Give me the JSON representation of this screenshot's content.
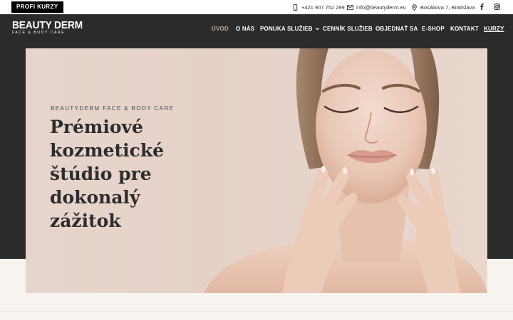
{
  "topbar": {
    "profi_button": "PROFI KURZY",
    "phone": "+421 907 752 299",
    "email": "info@beautyderm.eu",
    "address": "Bosákova 7, Bratislava"
  },
  "logo": {
    "main": "BEAUTY DERM",
    "sub": "FACE & BODY CARE"
  },
  "nav": {
    "items": [
      {
        "label": "ÚVOD"
      },
      {
        "label": "O NÁS"
      },
      {
        "label": "PONUKA SLUŽIEB"
      },
      {
        "label": "CENNÍK SLUŽIEB"
      },
      {
        "label": "OBJEDNAŤ SA"
      },
      {
        "label": "E-SHOP"
      },
      {
        "label": "KONTAKT"
      },
      {
        "label": "KURZY"
      }
    ],
    "active_color": "#bfa89a"
  },
  "hero": {
    "kicker": "BEAUTYDERM FACE & BODY CARE",
    "headline": "Prémiové kozmetické štúdio pre dokonalý zážitok"
  },
  "colors": {
    "header_bg": "#2b2b2b",
    "hero_bg": "#e7d5cd",
    "page_bg": "#f7f4f0"
  }
}
